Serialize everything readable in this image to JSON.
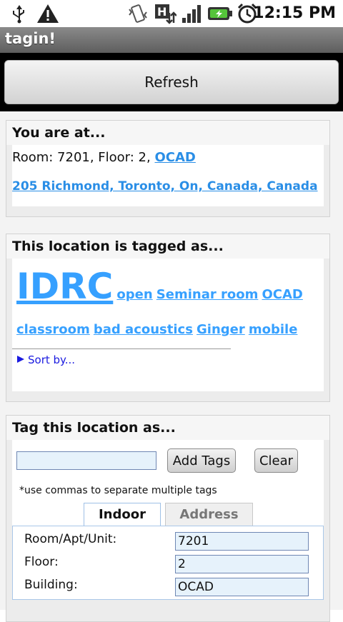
{
  "status_bar": {
    "time": "12:15 PM",
    "icons": [
      "usb-icon",
      "warning-icon",
      "vibrate-icon",
      "hsdpa-icon",
      "signal-icon",
      "battery-icon",
      "alarm-icon"
    ]
  },
  "app": {
    "title": "tagin!"
  },
  "toolbar": {
    "refresh_label": "Refresh"
  },
  "location": {
    "heading": "You are at...",
    "room_floor_prefix": "Room: 7201, Floor: 2,",
    "building_link": "OCAD",
    "address_link": "205 Richmond, Toronto, On, Canada, Canada"
  },
  "tags": {
    "heading": "This location is tagged as...",
    "items": [
      {
        "label": "IDRC",
        "weight": "large"
      },
      {
        "label": "open",
        "weight": "small"
      },
      {
        "label": "Seminar room",
        "weight": "small"
      },
      {
        "label": "OCAD",
        "weight": "small"
      },
      {
        "label": "classroom",
        "weight": "small"
      },
      {
        "label": "bad acoustics",
        "weight": "small"
      },
      {
        "label": "Ginger",
        "weight": "small"
      },
      {
        "label": "mobile",
        "weight": "small"
      }
    ],
    "sort_label": "Sort by..."
  },
  "tag_form": {
    "heading": "Tag this location as...",
    "input_value": "",
    "add_label": "Add Tags",
    "clear_label": "Clear",
    "hint": "*use commas to separate multiple tags",
    "tabs": [
      {
        "label": "Indoor",
        "active": true
      },
      {
        "label": "Address",
        "active": false
      }
    ],
    "fields": [
      {
        "label": "Room/Apt/Unit:",
        "value": "7201"
      },
      {
        "label": "Floor:",
        "value": "2"
      },
      {
        "label": "Building:",
        "value": "OCAD"
      }
    ]
  },
  "colors": {
    "link": "#2a8ee6",
    "tag": "#36a0ff",
    "sort": "#1a1ae0",
    "titlebar": "#6e6e6e"
  }
}
